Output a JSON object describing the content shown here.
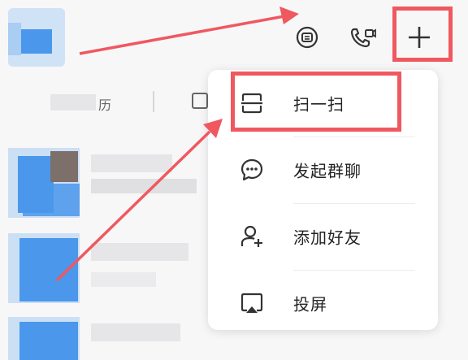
{
  "header": {
    "tab_fragment": "历"
  },
  "menu": {
    "items": [
      {
        "label": "扫一扫",
        "icon": "scan-icon"
      },
      {
        "label": "发起群聊",
        "icon": "chat-bubble-icon"
      },
      {
        "label": "添加好友",
        "icon": "add-user-icon"
      },
      {
        "label": "投屏",
        "icon": "screen-cast-icon"
      }
    ]
  },
  "colors": {
    "annotation_red": "#f0585f",
    "avatar_blue": "#4a97ec",
    "text_dark": "#222222"
  }
}
